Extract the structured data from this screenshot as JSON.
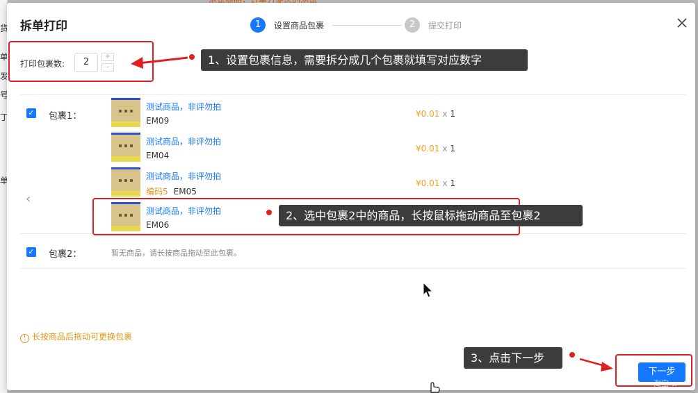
{
  "background": {
    "left_chars": [
      "货",
      "单",
      "发",
      "号",
      "丁",
      "单"
    ],
    "top_notice": "测试商品，订单方便您的测试"
  },
  "modal": {
    "title": "拆单打印",
    "steps": [
      {
        "num": "1",
        "label": "设置商品包裹",
        "active": true
      },
      {
        "num": "2",
        "label": "提交打印",
        "active": false
      }
    ],
    "count_label": "打印包裹数:",
    "count_value": "2",
    "spin_up": "+",
    "spin_down": "-",
    "prev_icon": "‹",
    "packages": [
      {
        "label": "包裹1：",
        "checked": true,
        "items": [
          {
            "name": "测试商品，非评勿拍",
            "code": "EM09",
            "code_label": "",
            "price": "¥0.01",
            "times": "x",
            "qty": "1"
          },
          {
            "name": "测试商品，非评勿拍",
            "code": "EM04",
            "code_label": "",
            "price": "¥0.01",
            "times": "x",
            "qty": "1"
          },
          {
            "name": "测试商品，非评勿拍",
            "code": "EM05",
            "code_label": "编码5",
            "price": "¥0.01",
            "times": "x",
            "qty": "1"
          },
          {
            "name": "测试商品，非评勿拍",
            "code": "EM06",
            "code_label": "",
            "price": "",
            "times": "",
            "qty": ""
          }
        ]
      },
      {
        "label": "包裹2：",
        "checked": true,
        "empty_text": "暂无商品，请长按商品拖动至此包裹。"
      }
    ],
    "tip": "长按商品后拖动可更换包裹",
    "tip_icon": "!",
    "next_button": "下一步"
  },
  "annotations": [
    "1、设置包裹信息，需要拆分成几个包裹就填写对应数字",
    "2、选中包裹2中的商品，长按鼠标拖动商品至包裹2",
    "3、点击下一步"
  ],
  "watermark": "淘宝 w",
  "colors": {
    "primary": "#1677ff",
    "annotation_red": "#e02020",
    "price_orange": "#f0a020",
    "callout_bg": "#3c3c3c"
  }
}
